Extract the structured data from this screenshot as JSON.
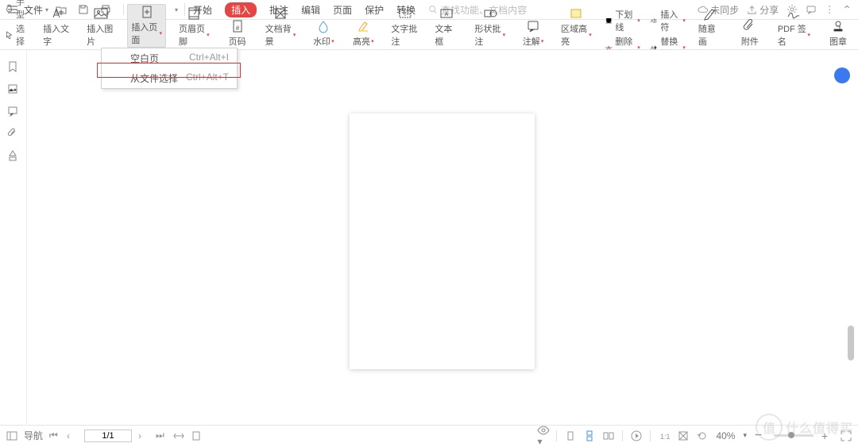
{
  "top": {
    "file_label": "文件",
    "tabs": {
      "start": "开始",
      "insert": "插入",
      "annot": "批注",
      "edit": "编辑",
      "page": "页面",
      "protect": "保护",
      "convert": "转换"
    },
    "search_placeholder": "查找功能、文档内容",
    "right": {
      "nosync": "未同步",
      "share": "分享"
    }
  },
  "ribbon": {
    "hand": "手型",
    "select": "选择",
    "insert_text": "插入文字",
    "insert_image": "插入图片",
    "insert_page": "插入页面",
    "header_footer": "页眉页脚",
    "page_num": "页码",
    "doc_bg": "文档背景",
    "watermark": "水印",
    "highlight": "高亮",
    "text_annot": "文字批注",
    "text_box": "文本框",
    "shape_annot": "形状批注",
    "note": "注解",
    "area_highlight": "区域高亮",
    "underline": "下划线",
    "delete_line": "删除线",
    "insert_char": "插入符",
    "replace_char": "替换符",
    "free_draw": "随意画",
    "attachment": "附件",
    "pdf_sign": "PDF 签名",
    "stamp": "图章"
  },
  "dropdown": {
    "blank": {
      "label": "空白页",
      "shortcut": "Ctrl+Alt+I"
    },
    "from_file": {
      "label": "从文件选择",
      "shortcut": "Ctrl+Alt+T"
    }
  },
  "status": {
    "nav": "导航",
    "page": "1/1",
    "zoom": "40%"
  },
  "watermark": {
    "char": "值",
    "text": "什么值得买"
  }
}
